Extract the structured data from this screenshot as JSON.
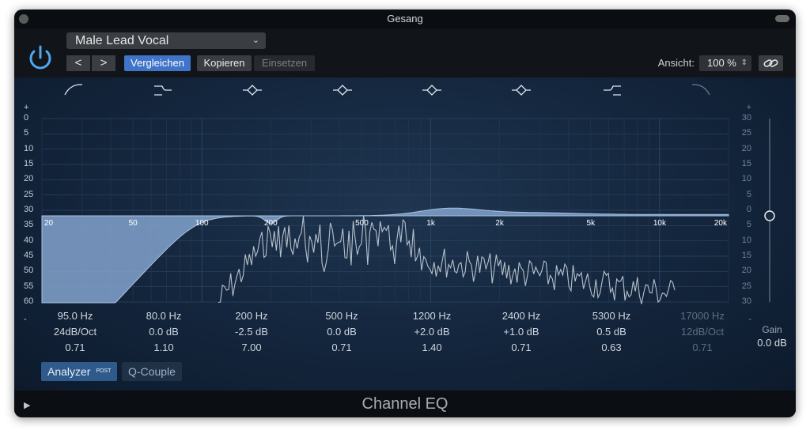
{
  "window": {
    "title": "Gesang"
  },
  "header": {
    "preset": "Male Lead Vocal",
    "prev": "<",
    "next": ">",
    "compare": "Vergleichen",
    "copy": "Kopieren",
    "paste": "Einsetzen",
    "view_label": "Ansicht:",
    "zoom": "100 %"
  },
  "graph": {
    "left_db_labels": [
      "+",
      "0",
      "5",
      "10",
      "15",
      "20",
      "25",
      "30",
      "35",
      "40",
      "45",
      "50",
      "55",
      "60",
      "-"
    ],
    "right_db_labels": [
      "+",
      "30",
      "25",
      "20",
      "15",
      "10",
      "5",
      "0",
      "5",
      "10",
      "15",
      "20",
      "25",
      "30",
      "-"
    ],
    "freq_labels": [
      "20",
      "50",
      "100",
      "200",
      "500",
      "1k",
      "2k",
      "5k",
      "10k",
      "20k"
    ]
  },
  "bands": [
    {
      "icon": "low-cut-icon",
      "freq": "95.0 Hz",
      "param": "24dB/Oct",
      "q": "0.71",
      "enabled": true
    },
    {
      "icon": "low-shelf-icon",
      "freq": "80.0 Hz",
      "param": "0.0 dB",
      "q": "1.10",
      "enabled": true
    },
    {
      "icon": "bell-icon",
      "freq": "200 Hz",
      "param": "-2.5 dB",
      "q": "7.00",
      "enabled": true
    },
    {
      "icon": "bell-icon",
      "freq": "500 Hz",
      "param": "0.0 dB",
      "q": "0.71",
      "enabled": true
    },
    {
      "icon": "bell-icon",
      "freq": "1200 Hz",
      "param": "+2.0 dB",
      "q": "1.40",
      "enabled": true
    },
    {
      "icon": "bell-icon",
      "freq": "2400 Hz",
      "param": "+1.0 dB",
      "q": "0.71",
      "enabled": true
    },
    {
      "icon": "high-shelf-icon",
      "freq": "5300 Hz",
      "param": "0.5 dB",
      "q": "0.63",
      "enabled": true
    },
    {
      "icon": "high-cut-icon",
      "freq": "17000 Hz",
      "param": "12dB/Oct",
      "q": "0.71",
      "enabled": false
    }
  ],
  "gain": {
    "label": "Gain",
    "value": "0.0 dB"
  },
  "buttons": {
    "analyzer": "Analyzer",
    "analyzer_badge": "POST",
    "q_couple": "Q-Couple"
  },
  "footer": {
    "title": "Channel EQ"
  },
  "colors": {
    "accent": "#3f74c8",
    "curve_fill": "#7f9fc8",
    "panel_bg": "#152840"
  }
}
